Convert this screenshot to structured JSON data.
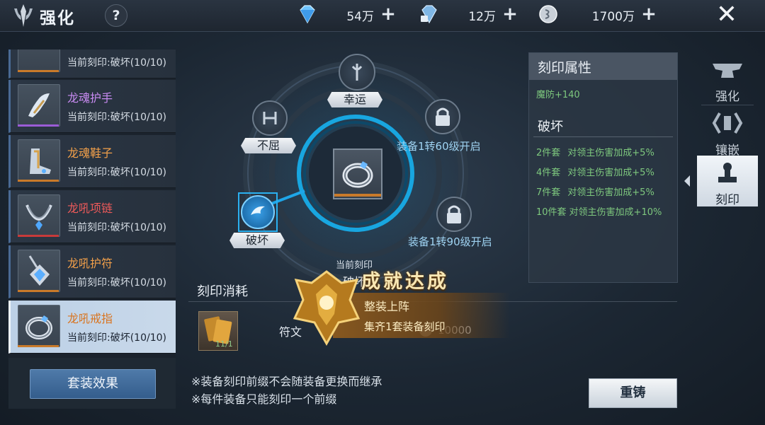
{
  "header": {
    "title": "强化",
    "help_label": "?",
    "resources": [
      {
        "icon": "diamond-icon",
        "value": "54万"
      },
      {
        "icon": "bound-diamond-icon",
        "value": "12万"
      },
      {
        "icon": "silver-coin-icon",
        "value": "1700万"
      }
    ],
    "close_label": "✕"
  },
  "equipment_list": [
    {
      "name": "",
      "status": "当前刻印:破坏(10/10)",
      "name_color": "#f2a04a",
      "bar_color": "#c97a2a"
    },
    {
      "name": "龙魂护手",
      "status": "当前刻印:破坏(10/10)",
      "name_color": "#c98bf2",
      "bar_color": "#9b5cd6"
    },
    {
      "name": "龙魂鞋子",
      "status": "当前刻印:破坏(10/10)",
      "name_color": "#f2a04a",
      "bar_color": "#c97a2a"
    },
    {
      "name": "龙吼项链",
      "status": "当前刻印:破坏(10/10)",
      "name_color": "#ee5a5a",
      "bar_color": "#c83a3a"
    },
    {
      "name": "龙吼护符",
      "status": "当前刻印:破坏(10/10)",
      "name_color": "#f2a04a",
      "bar_color": "#c97a2a"
    },
    {
      "name": "龙吼戒指",
      "status": "当前刻印:破坏(10/10)",
      "name_color": "#d9741f",
      "bar_color": "#c97a2a",
      "selected": true
    }
  ],
  "set_effect_button": "套装效果",
  "wheel": {
    "nodes": {
      "luck": "幸运",
      "unyielding": "不屈",
      "destroy": "破坏"
    },
    "locked": [
      "装备1转60级开启",
      "装备1转90级开启"
    ],
    "current_label": "当前刻印",
    "current_value": "破坏"
  },
  "cost": {
    "title": "刻印消耗",
    "item_count": "11/1",
    "item_label": "符文",
    "amount": "10000"
  },
  "notes": [
    "※装备刻印前缀不会随装备更换而继承",
    "※每件装备只能刻印一个前缀"
  ],
  "recast_button": "重铸",
  "attributes": {
    "title": "刻印属性",
    "value": "魔防+140",
    "set_title": "破坏",
    "bonuses": [
      {
        "pieces": "2件套",
        "effect": "对领主伤害加成+5%"
      },
      {
        "pieces": "4件套",
        "effect": "对领主伤害加成+5%"
      },
      {
        "pieces": "7件套",
        "effect": "对领主伤害加成+5%"
      },
      {
        "pieces": "10件套",
        "effect": "对领主伤害加成+10%"
      }
    ]
  },
  "side_tabs": [
    {
      "label": "强化",
      "icon": "anvil-icon"
    },
    {
      "label": "镶嵌",
      "icon": "gem-socket-icon"
    },
    {
      "label": "刻印",
      "icon": "stamp-icon",
      "active": true
    }
  ],
  "achievement": {
    "title": "成就达成",
    "line1": "整装上阵",
    "line2": "集齐1套装备刻印"
  }
}
